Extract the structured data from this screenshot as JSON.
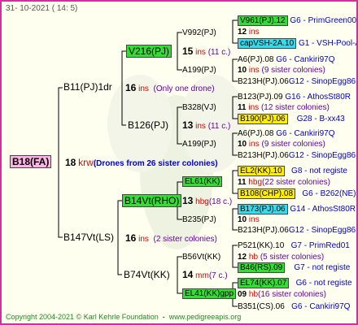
{
  "header": {
    "date": "31- 10-2021 ( 14: 5)"
  },
  "footer": {
    "copyright": "Copyright 2004-2021 © Karl Kehrle Foundation",
    "url": "www.pedigreeapis.org"
  },
  "colors": {
    "border": "#cc3399",
    "background": "#fffff0",
    "green": "#33dd33",
    "cyan": "#33ddee",
    "yellow": "#ffee00",
    "pink": "#ffb3e6",
    "line": "#000000"
  },
  "root": {
    "name": "B18(FA)",
    "num": "18",
    "suffix": "krw",
    "note": "(Drones from 26 sister colonies)"
  },
  "gen1": [
    {
      "name": "B11(PJ)1dr",
      "num": "16",
      "suffix": "ins",
      "note": "(Only one drone)"
    },
    {
      "name": "B147Vt(LS)",
      "num": "16",
      "suffix": "ins",
      "note": "(2 sister colonies)"
    }
  ],
  "gen2": [
    {
      "name": "V216(PJ)",
      "num": "15",
      "suffix": "ins",
      "note": "(11 c.)"
    },
    {
      "name": "B126(PJ)",
      "num": "13",
      "suffix": "ins",
      "note": "(11 c.)"
    },
    {
      "name": "B14Vt(RHO)",
      "num": "13",
      "suffix": "hbg",
      "note": "(18 c.)"
    },
    {
      "name": "B74Vt(KK)",
      "num": "14",
      "suffix": "mm",
      "note": "(7 c.)"
    }
  ],
  "gen3": [
    {
      "name": "V992(PJ)",
      "num": "13",
      "suffix": "ins",
      "note": "(11 c.)"
    },
    {
      "name": "A199(PJ)"
    },
    {
      "name": "B328(VJ)",
      "num": "13",
      "suffix": "ins",
      "note": "(11 c.)"
    },
    {
      "name": "A199(PJ)"
    },
    {
      "name": "EL61(KK)",
      "num": "13",
      "suffix": "hbg",
      "note": "(18 c.)"
    },
    {
      "name": "B235(PJ)"
    },
    {
      "name": "B56Vt(KK)",
      "num": "14",
      "suffix": "mm",
      "note": "(7 c.)"
    },
    {
      "name": "EL41(KK)gpp"
    }
  ],
  "gen4": [
    {
      "left": "V961(PJ).12",
      "right": "G6 - PrimGreen00"
    },
    {
      "num": "12",
      "suffix": "ins"
    },
    {
      "left": "capVSH-2A.10",
      "right": "G1 - VSH-Pool-AR"
    },
    {
      "left": "A6(PJ).08",
      "right": "G6 - Cankiri97Q"
    },
    {
      "num": "10",
      "suffix": "ins",
      "note": "(9 sister colonies)"
    },
    {
      "left": "B213H(PJ).06",
      "right": "G12 - SinopEgg86R"
    },
    {
      "left": "B123(PJ).09",
      "right": "G16 - AthosSt80R"
    },
    {
      "num": "11",
      "suffix": "ins",
      "note": "(12 sister colonies)"
    },
    {
      "left": "B190(PJ).06",
      "right": "G28 - B-xx43"
    },
    {
      "left": "A6(PJ).08",
      "right": "G6 - Cankiri97Q"
    },
    {
      "num": "10",
      "suffix": "ins",
      "note": "(9 sister colonies)"
    },
    {
      "left": "B213H(PJ).06",
      "right": "G12 - SinopEgg86R"
    },
    {
      "left": "EL2(KK).10",
      "right": "G8 - not registe"
    },
    {
      "num": "11",
      "suffix": "hbg",
      "note": "(22 sister colonies)"
    },
    {
      "left": "B108(CHP).08",
      "right": "G6 - B262(NE)"
    },
    {
      "left": "B173(PJ).06",
      "right": "G14 - AthosSt80R"
    },
    {
      "num": "10",
      "suffix": "ins"
    },
    {
      "left": "B213H(PJ).06",
      "right": "G12 - SinopEgg86R"
    },
    {
      "left": "P521(KK).10",
      "right": "G7 - PrimRed01"
    },
    {
      "num": "12",
      "suffix": "hb",
      "note": "(5 sister colonies)"
    },
    {
      "left": "B46(RS).09",
      "right": "G7 - not registe"
    },
    {
      "left": "EL74(KK).07",
      "right": "G6 - not registe"
    },
    {
      "num": "09",
      "suffix": "hb",
      "note": "(16 sister colonies)"
    },
    {
      "left": "B351(CS).06",
      "right": "G6 - Cankiri97Q"
    }
  ]
}
